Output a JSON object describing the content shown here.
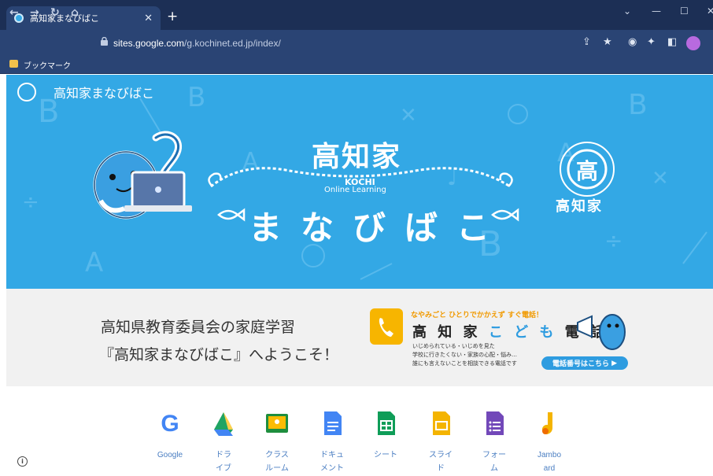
{
  "browser": {
    "tab_title": "高知家まなびばこ",
    "url_domain": "sites.google.com",
    "url_path": "/g.kochinet.ed.jp/index/",
    "bookmark_folder": "ブックマーク"
  },
  "banner": {
    "site_name": "高知家まなびばこ",
    "title": "高知家",
    "kochi": "KOCHI",
    "online": "Online Learning",
    "manabi": "まなびばこ",
    "seal_name": "高知家"
  },
  "intro": {
    "line1": "高知県教育委員会の家庭学習",
    "line2": "『高知家まなびばこ』へようこそ！"
  },
  "kodomo_denwa": {
    "tagline": "なやみごと ひとりでかかえず すぐ電話！",
    "title_a": "高 知 家",
    "title_b": "こ ど も",
    "title_c": "電 話",
    "line1": "いじめられている・いじめを見た",
    "line2": "学校に行きたくない・家族の心配・悩み…",
    "line3": "誰にも言えないことを相談できる電話です",
    "button": "電話番号はこちら"
  },
  "apps": [
    {
      "label": "Google",
      "icon": "google-icon",
      "color": "#4285f4"
    },
    {
      "label": "ドラ\nイブ",
      "icon": "drive-icon",
      "color": "#1fa463"
    },
    {
      "label": "クラス\nルーム",
      "icon": "classroom-icon",
      "color": "#1e8e3e"
    },
    {
      "label": "ドキュ\nメント",
      "icon": "docs-icon",
      "color": "#4285f4"
    },
    {
      "label": "シート",
      "icon": "sheets-icon",
      "color": "#0f9d58"
    },
    {
      "label": "スライ\nド",
      "icon": "slides-icon",
      "color": "#f4b400"
    },
    {
      "label": "フォー\nム",
      "icon": "forms-icon",
      "color": "#7248b9"
    },
    {
      "label": "Jambo\nard",
      "icon": "jamboard-icon",
      "color": "#f4b400"
    }
  ]
}
